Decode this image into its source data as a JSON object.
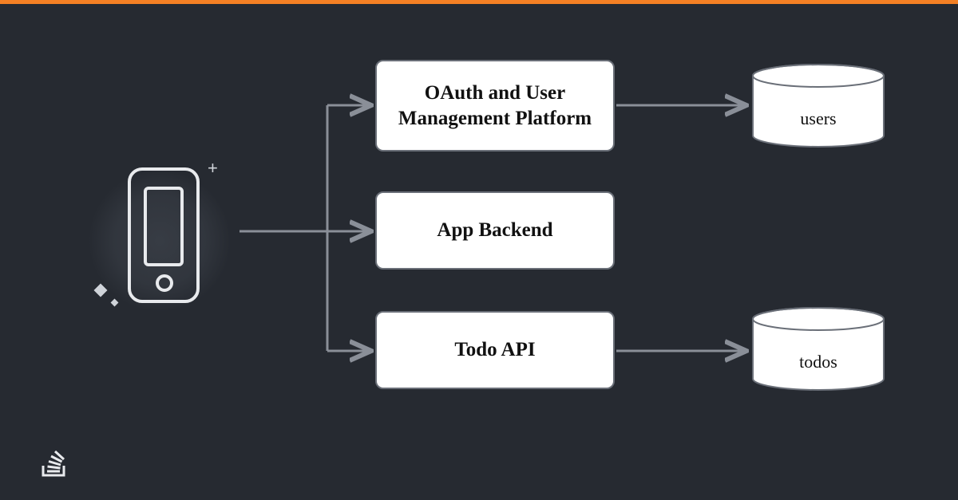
{
  "diagram": {
    "client_icon": "mobile-phone-icon",
    "services": {
      "oauth": "OAuth and User Management Platform",
      "backend": "App Backend",
      "todo": "Todo API"
    },
    "databases": {
      "users": "users",
      "todos": "todos"
    }
  },
  "colors": {
    "background": "#262a31",
    "accent_bar": "#f48024",
    "box_fill": "#ffffff",
    "box_border": "#6a6f78",
    "connector": "#8a8f98",
    "icon_stroke": "#e8eaed"
  },
  "brand_icon": "stackoverflow-logo"
}
